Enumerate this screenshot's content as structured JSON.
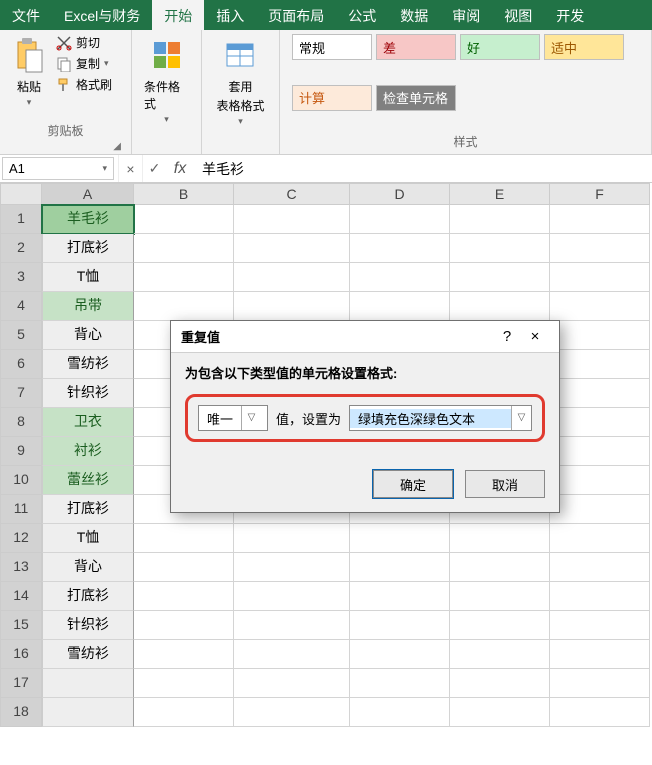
{
  "tabs": [
    "文件",
    "Excel与财务",
    "开始",
    "插入",
    "页面布局",
    "公式",
    "数据",
    "审阅",
    "视图",
    "开发"
  ],
  "active_tab_index": 2,
  "ribbon": {
    "clipboard": {
      "paste": "粘贴",
      "cut": "剪切",
      "copy": "复制",
      "format_painter": "格式刷",
      "group_label": "剪贴板"
    },
    "cond_format": "条件格式",
    "table_format_l1": "套用",
    "table_format_l2": "表格格式",
    "styles": {
      "group_label": "样式",
      "items": [
        {
          "label": "常规",
          "bg": "#ffffff",
          "fg": "#000000"
        },
        {
          "label": "差",
          "bg": "#f7c7c6",
          "fg": "#9c0006"
        },
        {
          "label": "好",
          "bg": "#c6efce",
          "fg": "#006100"
        },
        {
          "label": "适中",
          "bg": "#ffe699",
          "fg": "#9c5700"
        },
        {
          "label": "计算",
          "bg": "#fdeada",
          "fg": "#c65911"
        },
        {
          "label": "检查单元格",
          "bg": "#808080",
          "fg": "#ffffff"
        }
      ]
    }
  },
  "namebox": "A1",
  "formula_value": "羊毛衫",
  "columns": [
    "A",
    "B",
    "C",
    "D",
    "E",
    "F"
  ],
  "rows": [
    {
      "n": 1,
      "a": "羊毛衫",
      "hl": true,
      "a1": true
    },
    {
      "n": 2,
      "a": "打底衫"
    },
    {
      "n": 3,
      "a": "T恤"
    },
    {
      "n": 4,
      "a": "吊带",
      "hl": true
    },
    {
      "n": 5,
      "a": "背心"
    },
    {
      "n": 6,
      "a": "雪纺衫"
    },
    {
      "n": 7,
      "a": "针织衫"
    },
    {
      "n": 8,
      "a": "卫衣",
      "hl": true
    },
    {
      "n": 9,
      "a": "衬衫",
      "hl": true
    },
    {
      "n": 10,
      "a": "蕾丝衫",
      "hl": true
    },
    {
      "n": 11,
      "a": "打底衫"
    },
    {
      "n": 12,
      "a": "T恤"
    },
    {
      "n": 13,
      "a": "背心"
    },
    {
      "n": 14,
      "a": "打底衫"
    },
    {
      "n": 15,
      "a": "针织衫"
    },
    {
      "n": 16,
      "a": "雪纺衫"
    },
    {
      "n": 17,
      "a": ""
    },
    {
      "n": 18,
      "a": ""
    }
  ],
  "dialog": {
    "title": "重复值",
    "help": "?",
    "close": "×",
    "instruction": "为包含以下类型值的单元格设置格式:",
    "type_value": "唯一",
    "mid_text": "值，设置为",
    "format_value": "绿填充色深绿色文本",
    "ok": "确定",
    "cancel": "取消"
  }
}
